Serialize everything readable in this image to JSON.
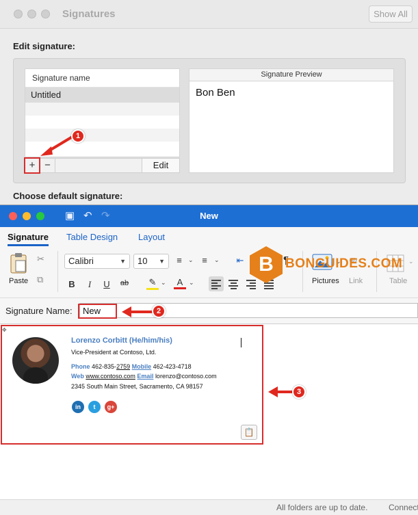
{
  "signatures_window": {
    "title": "Signatures",
    "show_all_label": "Show All",
    "edit_heading": "Edit signature:",
    "list_header": "Signature name",
    "signatures": [
      "Untitled"
    ],
    "add_label": "+",
    "remove_label": "−",
    "edit_label": "Edit",
    "preview_header": "Signature Preview",
    "preview_text": "Bon Ben",
    "choose_default_heading": "Choose default signature:"
  },
  "callouts": [
    "1",
    "2",
    "3"
  ],
  "new_window": {
    "title": "New",
    "tabs": [
      {
        "label": "Signature",
        "active": true
      },
      {
        "label": "Table Design",
        "active": false
      },
      {
        "label": "Layout",
        "active": false
      }
    ],
    "ribbon": {
      "paste_label": "Paste",
      "font_family": "Calibri",
      "font_size": "10",
      "pictures_label": "Pictures",
      "link_label": "Link",
      "table_label": "Table"
    },
    "signature_name_label": "Signature Name:",
    "signature_name_value": "New"
  },
  "signature_block": {
    "name": "Lorenzo Corbitt (He/him/his)",
    "title": "Vice-President at Contoso, Ltd.",
    "phone_label": "Phone",
    "phone_prefix": "462-835-",
    "phone_suffix": "2759",
    "mobile_label": "Mobile",
    "mobile": "462-423-4718",
    "web_label": "Web",
    "web": "www.contoso.com",
    "email_label": "Email",
    "email": "lorenzo@contoso.com",
    "address": "2345 South Main Street, Sacramento, CA 98157",
    "social": [
      {
        "glyph": "in",
        "icon": "linkedin-icon",
        "color": "#1f6fb2"
      },
      {
        "glyph": "t",
        "icon": "twitter-icon",
        "color": "#2a9fe0"
      },
      {
        "glyph": "g+",
        "icon": "google-plus-icon",
        "color": "#d9463a"
      }
    ]
  },
  "watermark": {
    "badge": "B",
    "text": "BONGUIDES.COM"
  },
  "status_bar": {
    "sync_text": "All folders are up to date.",
    "connection_text": "Connected"
  },
  "colors": {
    "accent_blue": "#1e6fd3",
    "annotation_red": "#d62d2d",
    "watermark_orange": "#e5801a"
  }
}
